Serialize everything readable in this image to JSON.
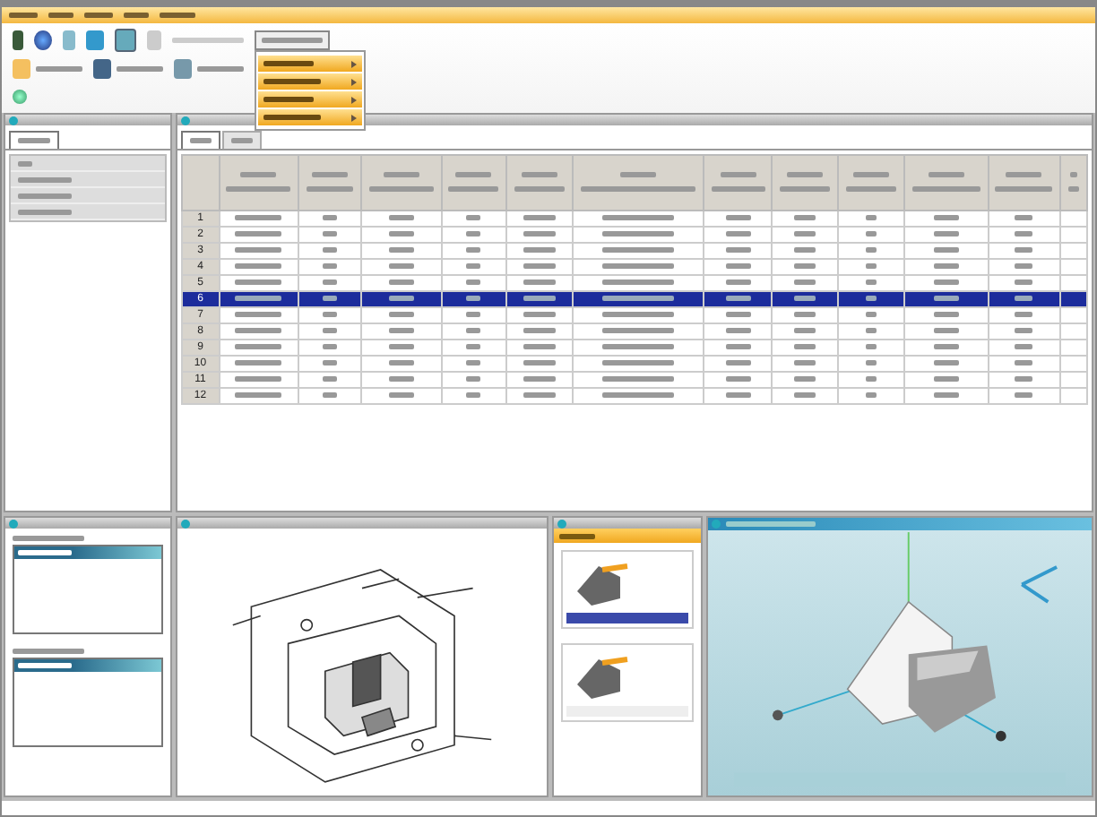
{
  "table_tabs": [
    {
      "selected": true
    },
    {
      "selected": false
    }
  ],
  "rows": [
    {
      "number": "1",
      "selected": false
    },
    {
      "number": "2",
      "selected": false
    },
    {
      "number": "3",
      "selected": false
    },
    {
      "number": "4",
      "selected": false
    },
    {
      "number": "5",
      "selected": false
    },
    {
      "number": "6",
      "selected": true
    },
    {
      "number": "7",
      "selected": false
    },
    {
      "number": "8",
      "selected": false
    },
    {
      "number": "9",
      "selected": false
    },
    {
      "number": "10",
      "selected": false
    },
    {
      "number": "11",
      "selected": false
    },
    {
      "number": "12",
      "selected": false
    }
  ],
  "side_lists": [
    {
      "items": [
        {
          "selected": true
        }
      ]
    },
    {
      "items": [
        {
          "selected": true
        }
      ]
    }
  ],
  "thumbnails": [
    {
      "selected": true
    },
    {
      "selected": false
    }
  ]
}
